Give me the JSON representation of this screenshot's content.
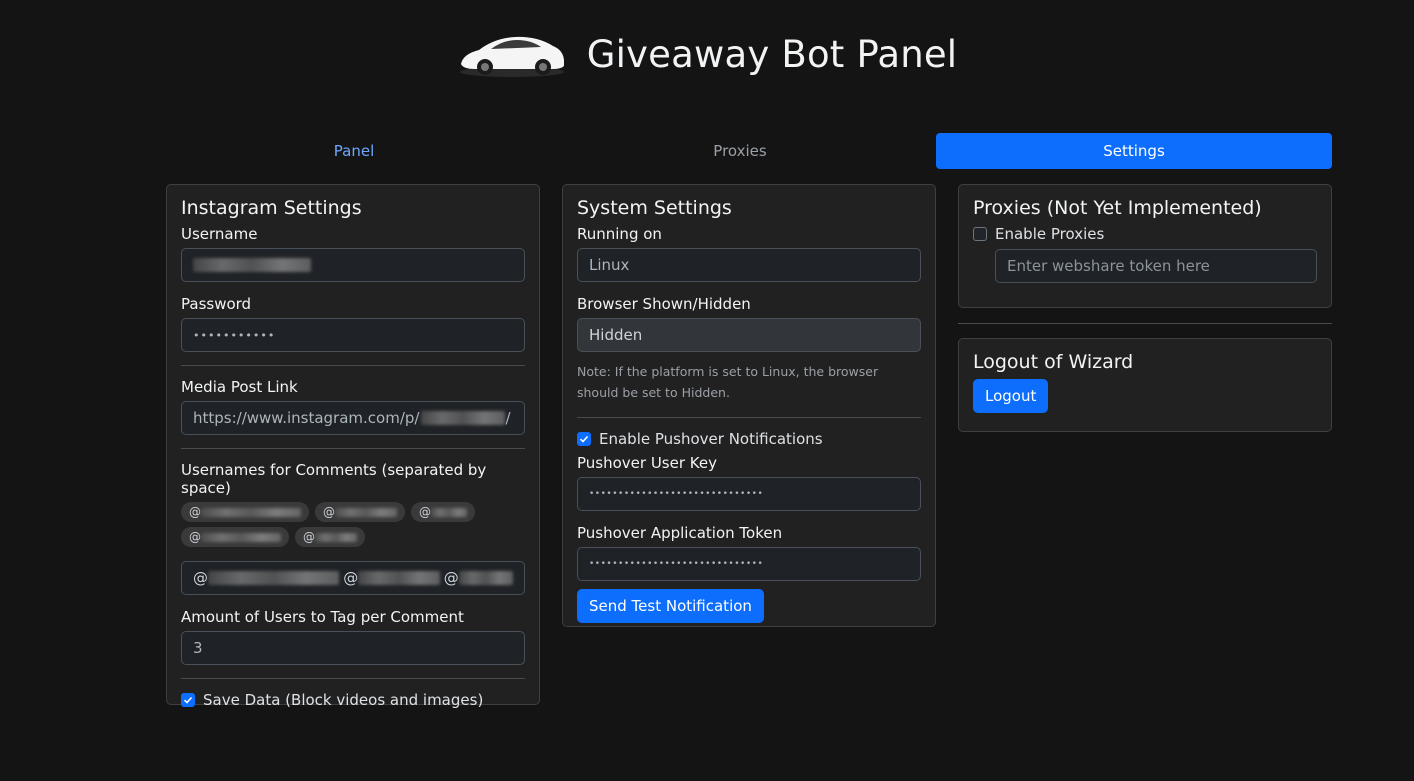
{
  "header": {
    "title": "Giveaway Bot Panel",
    "logo_icon": "car-icon"
  },
  "tabs": [
    {
      "label": "Panel",
      "active": false
    },
    {
      "label": "Proxies",
      "active": false
    },
    {
      "label": "Settings",
      "active": true
    }
  ],
  "instagram": {
    "title": "Instagram Settings",
    "username_label": "Username",
    "username_value": "",
    "password_label": "Password",
    "password_value": "•••••••••••",
    "media_label": "Media Post Link",
    "media_value_prefix": "https://www.instagram.com/p/",
    "media_value_suffix": "/",
    "usernames_label": "Usernames for Comments (separated by space)",
    "chips": [
      "@",
      "@",
      "@",
      "@",
      "@"
    ],
    "usernames_value": "@",
    "amount_label": "Amount of Users to Tag per Comment",
    "amount_value": "3",
    "save_data_label": "Save Data (Block videos and images)",
    "save_data_checked": true
  },
  "system": {
    "title": "System Settings",
    "running_label": "Running on",
    "running_value": "Linux",
    "browser_label": "Browser Shown/Hidden",
    "browser_value": "Hidden",
    "note": "Note: If the platform is set to Linux, the browser should be set to Hidden.",
    "pushover_enable_label": "Enable Pushover Notifications",
    "pushover_checked": true,
    "user_key_label": "Pushover User Key",
    "user_key_value": "••••••••••••••••••••••••••••••",
    "app_token_label": "Pushover Application Token",
    "app_token_value": "••••••••••••••••••••••••••••••",
    "test_button": "Send Test Notification"
  },
  "proxies": {
    "title": "Proxies (Not Yet Implemented)",
    "enable_label": "Enable Proxies",
    "enable_checked": false,
    "token_placeholder": "Enter webshare token here"
  },
  "logout": {
    "title": "Logout of Wizard",
    "button": "Logout"
  },
  "colors": {
    "accent": "#0d6efd",
    "background": "#141414",
    "card": "#212121"
  }
}
